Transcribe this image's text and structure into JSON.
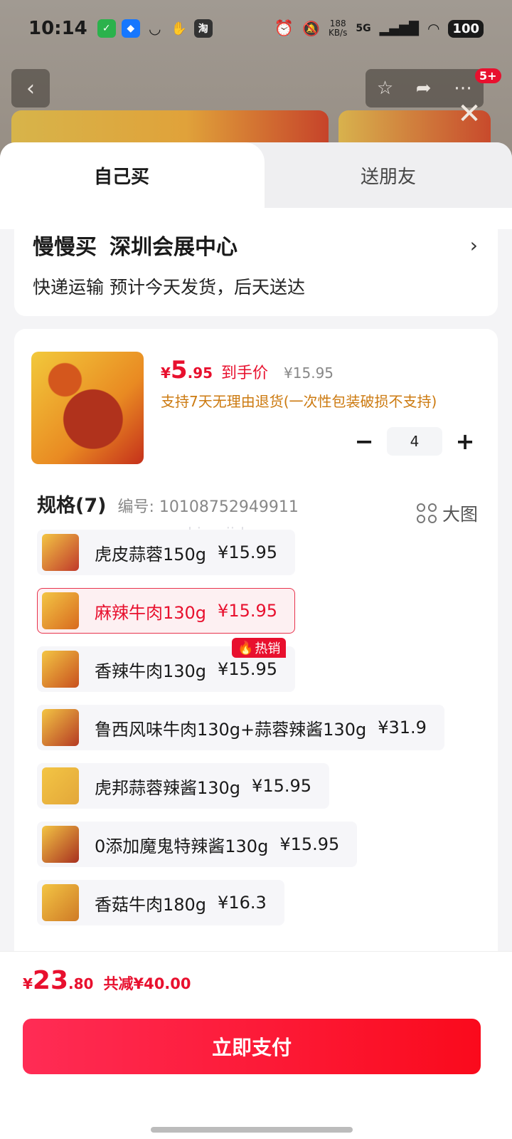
{
  "status_bar": {
    "time": "10:14",
    "app_icons": [
      "wechat-icon",
      "alipay-icon",
      "shield-icon",
      "handshake-icon",
      "taobao-icon"
    ],
    "net_speed_value": "188",
    "net_speed_unit": "KB/s",
    "network": "5G",
    "battery": "100"
  },
  "header": {
    "cart_badge": "5+"
  },
  "tabs": {
    "self": "自己买",
    "gift": "送朋友"
  },
  "address": {
    "store": "慢慢买",
    "location": "深圳会展中心",
    "chevron": "›",
    "delivery": "快递运输 预计今天发货，后天送达"
  },
  "product": {
    "price_currency": "¥",
    "price_int": "5",
    "price_dec": ".95",
    "price_tag": "到手价",
    "original_price": "¥15.95",
    "return_note": "支持7天无理由退货(一次性包装破损不支持)",
    "quantity": "4",
    "minus": "−",
    "plus": "+"
  },
  "specs": {
    "title": "规格(7)",
    "code": "编号: 10108752949911",
    "big_image_label": "大图",
    "watermark": "kimojidesu",
    "hot_label": "热销",
    "options": [
      {
        "label": "虎皮蒜蓉150g",
        "price": "¥15.95",
        "thumb_color": "#c0392b"
      },
      {
        "label": "麻辣牛肉130g",
        "price": "¥15.95",
        "thumb_color": "#d86a1f"
      },
      {
        "label": "香辣牛肉130g",
        "price": "¥15.95",
        "thumb_color": "#c8501e"
      },
      {
        "label": "鲁西风味牛肉130g+蒜蓉辣酱130g",
        "price": "¥31.9",
        "thumb_color": "#b53a24"
      },
      {
        "label": "虎邦蒜蓉辣酱130g",
        "price": "¥15.95",
        "thumb_color": "#e3a73a"
      },
      {
        "label": "0添加魔鬼特辣酱130g",
        "price": "¥15.95",
        "thumb_color": "#a83020"
      },
      {
        "label": "香菇牛肉180g",
        "price": "¥16.3",
        "thumb_color": "#cf7a26"
      }
    ],
    "selected_index": 1
  },
  "footer": {
    "total_currency": "¥",
    "total_int": "23",
    "total_dec": ".80",
    "saved": "共减¥40.00",
    "pay_button": "立即支付"
  },
  "colors": {
    "accent": "#e8102e",
    "return_note": "#cc7a10"
  }
}
